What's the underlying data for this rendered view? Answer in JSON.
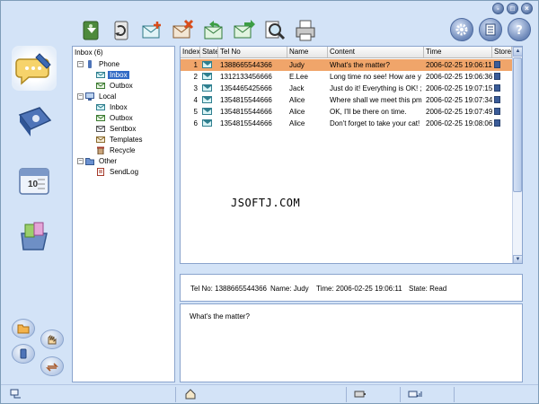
{
  "window": {
    "controls": [
      "-",
      "□",
      "×"
    ]
  },
  "toolbar": {
    "icons": [
      "receive-icon",
      "send-recycle-icon",
      "new-message-icon",
      "delete-message-icon",
      "reply-icon",
      "forward-icon",
      "search-icon",
      "print-icon"
    ],
    "right_icons": [
      "settings-icon",
      "notes-icon",
      "help-icon"
    ]
  },
  "sidebar": {
    "big": [
      "messages-icon",
      "phonebook-icon",
      "calendar-icon",
      "files-icon"
    ],
    "small": [
      "folder-icon",
      "hand-icon",
      "phone-icon",
      "sync-icon"
    ]
  },
  "tree": {
    "title": "Inbox (6)",
    "items": [
      {
        "label": "Phone",
        "level": 0,
        "expander": "−",
        "icon": "phone"
      },
      {
        "label": "Inbox",
        "level": 1,
        "icon": "inbox",
        "selected": true
      },
      {
        "label": "Outbox",
        "level": 1,
        "icon": "outbox"
      },
      {
        "label": "Local",
        "level": 0,
        "expander": "−",
        "icon": "computer"
      },
      {
        "label": "Inbox",
        "level": 1,
        "icon": "inbox"
      },
      {
        "label": "Outbox",
        "level": 1,
        "icon": "outbox"
      },
      {
        "label": "Sentbox",
        "level": 1,
        "icon": "sentbox"
      },
      {
        "label": "Templates",
        "level": 1,
        "icon": "templates"
      },
      {
        "label": "Recycle",
        "level": 1,
        "icon": "recycle"
      },
      {
        "label": "Other",
        "level": 0,
        "expander": "−",
        "icon": "folder"
      },
      {
        "label": "SendLog",
        "level": 1,
        "icon": "log"
      }
    ]
  },
  "list": {
    "columns": [
      "Index",
      "State",
      "Tel No",
      "Name",
      "Content",
      "Time",
      "Store"
    ],
    "rows": [
      {
        "index": "1",
        "tel": "1388665544366",
        "name": "Judy",
        "content": "What's the matter?",
        "time": "2006-02-25 19:06:11",
        "selected": true
      },
      {
        "index": "2",
        "tel": "1312133456666",
        "name": "E.Lee",
        "content": "Long time no see! How are y",
        "time": "2006-02-25 19:06:36"
      },
      {
        "index": "3",
        "tel": "1354465425666",
        "name": "Jack",
        "content": "Just do it! Everything is OK! ;",
        "time": "2006-02-25 19:07:15"
      },
      {
        "index": "4",
        "tel": "1354815544666",
        "name": "Alice",
        "content": "Where shall we meet this pm",
        "time": "2006-02-25 19:07:34"
      },
      {
        "index": "5",
        "tel": "1354815544666",
        "name": "Alice",
        "content": "OK, I'll be there on time.",
        "time": "2006-02-25 19:07:49"
      },
      {
        "index": "6",
        "tel": "1354815544666",
        "name": "Alice",
        "content": "Don't forget to take your cat!",
        "time": "2006-02-25 19:08:06"
      }
    ]
  },
  "watermark": "JSOFTJ.COM",
  "detail": {
    "tel": "Tel No: 1388665544366",
    "name": "Name: Judy",
    "time": "Time: 2006-02-25 19:06:11",
    "state": "State: Read",
    "body": "What's the matter?"
  },
  "statusbar": {
    "icons": [
      "network-icon",
      "home-icon",
      "battery-icon",
      "signal-icon"
    ]
  },
  "colors": {
    "window_bg": "#d3e3f7",
    "selected_row": "#f0a56a",
    "tree_selection": "#316ac5"
  }
}
